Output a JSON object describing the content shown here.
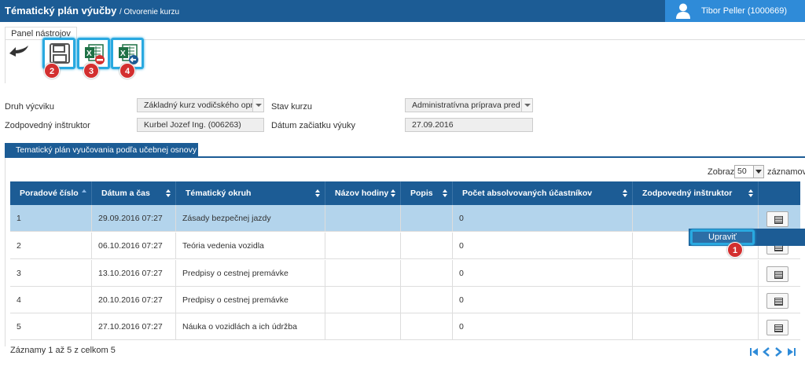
{
  "header": {
    "title": "Tématický plán výučby",
    "subtitle": "/ Otvorenie kurzu",
    "user": "Tibor Peller (1000669)"
  },
  "toolbar": {
    "panel_label": "Panel nástrojov",
    "buttons": [
      {
        "icon": "save-icon",
        "badge": "2"
      },
      {
        "icon": "excel-export-icon",
        "badge": "3"
      },
      {
        "icon": "excel-import-icon",
        "badge": "4"
      }
    ]
  },
  "form": {
    "druh_label": "Druh výcviku",
    "druh_value": "Základný kurz vodičského oprá",
    "stav_label": "Stav kurzu",
    "stav_value": "Administratívna príprava pred c",
    "instr_label": "Zodpovedný inštruktor",
    "instr_value": "Kurbel Jozef Ing. (006263)",
    "datum_label": "Dátum začiatku výuky",
    "datum_value": "27.09.2016"
  },
  "section": {
    "tab_label": "Tematický plán vyučovania podľa učebnej osnovy"
  },
  "grid": {
    "show_label": "Zobraz",
    "page_size": "50",
    "records_label": "záznamov",
    "columns": [
      "Poradové číslo",
      "Dátum a čas",
      "Tématický okruh",
      "Názov hodiny",
      "Popis",
      "Počet absolvovaných účastníkov",
      "Zodpovedný inštruktor"
    ],
    "rows": [
      {
        "num": "1",
        "date": "29.09.2016 07:27",
        "topic": "Zásady bezpečnej jazdy",
        "name": "",
        "desc": "",
        "count": "0",
        "instr": ""
      },
      {
        "num": "2",
        "date": "06.10.2016 07:27",
        "topic": "Teória vedenia vozidla",
        "name": "",
        "desc": "",
        "count": "0",
        "instr": ""
      },
      {
        "num": "3",
        "date": "13.10.2016 07:27",
        "topic": "Predpisy o cestnej premávke",
        "name": "",
        "desc": "",
        "count": "0",
        "instr": ""
      },
      {
        "num": "4",
        "date": "20.10.2016 07:27",
        "topic": "Predpisy o cestnej premávke",
        "name": "",
        "desc": "",
        "count": "0",
        "instr": ""
      },
      {
        "num": "5",
        "date": "27.10.2016 07:27",
        "topic": "Náuka o vozidlách a ich údržba",
        "name": "",
        "desc": "",
        "count": "0",
        "instr": ""
      }
    ],
    "summary": "Záznamy 1 až 5 z celkom 5"
  },
  "context_menu": {
    "item_label": "Upraviť",
    "badge": "1"
  },
  "colors": {
    "primary": "#1c5c95",
    "highlight": "#29a9e0",
    "badge": "#d32f2f",
    "selected_row": "#b3d4ec"
  }
}
